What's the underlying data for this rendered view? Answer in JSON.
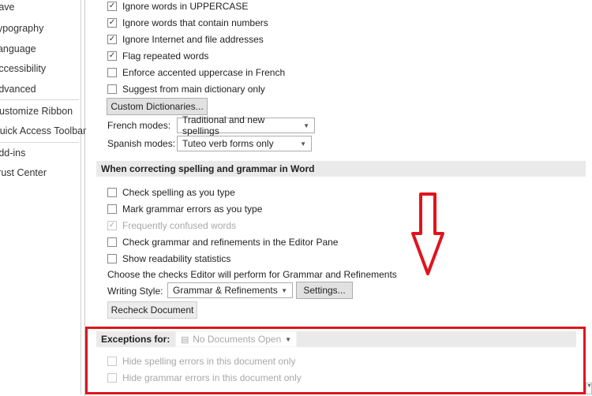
{
  "sidebar": {
    "items": [
      "Save",
      "Typography",
      "Language",
      "Accessibility",
      "Advanced",
      "Customize Ribbon",
      "Quick Access Toolbar",
      "Add-ins",
      "Trust Center"
    ]
  },
  "proofing": {
    "options": [
      {
        "label": "Ignore words in UPPERCASE",
        "checked": true
      },
      {
        "label": "Ignore words that contain numbers",
        "checked": true
      },
      {
        "label": "Ignore Internet and file addresses",
        "checked": true
      },
      {
        "label": "Flag repeated words",
        "checked": true
      },
      {
        "label": "Enforce accented uppercase in French",
        "checked": false
      },
      {
        "label": "Suggest from main dictionary only",
        "checked": false
      }
    ],
    "custom_dictionaries": "Custom Dictionaries...",
    "french_label": "French modes:",
    "french_value": "Traditional and new spellings",
    "spanish_label": "Spanish modes:",
    "spanish_value": "Tuteo verb forms only"
  },
  "word": {
    "header": "When correcting spelling and grammar in Word",
    "options": [
      {
        "label": "Check spelling as you type",
        "checked": false
      },
      {
        "label": "Mark grammar errors as you type",
        "checked": false
      },
      {
        "label": "Frequently confused words",
        "checked": true,
        "disabled": true
      },
      {
        "label": "Check grammar and refinements in the Editor Pane",
        "checked": false
      },
      {
        "label": "Show readability statistics",
        "checked": false
      }
    ],
    "checks_text": "Choose the checks Editor will perform for Grammar and Refinements",
    "writing_style_label": "Writing Style:",
    "writing_style_value": "Grammar & Refinements",
    "settings": "Settings...",
    "recheck": "Recheck Document"
  },
  "exceptions": {
    "label": "Exceptions for:",
    "value": "No Documents Open",
    "options": [
      {
        "label": "Hide spelling errors in this document only",
        "checked": false
      },
      {
        "label": "Hide grammar errors in this document only",
        "checked": false
      }
    ]
  },
  "colors": {
    "highlight": "#e0141e"
  }
}
